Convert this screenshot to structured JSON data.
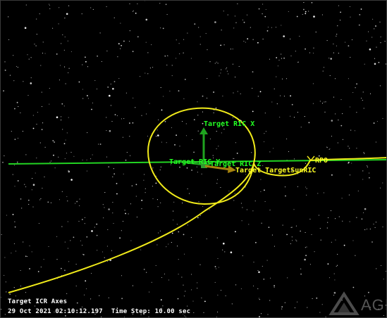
{
  "scene": {
    "axis_labels": {
      "ric_x": "Target RIC X",
      "ric_y": "Target RIC Y",
      "ric_z": "Target RIC Z",
      "sun_ric": "Target TargetSunRIC"
    },
    "object_labels": {
      "rpo": "RPO"
    },
    "colors": {
      "trajectory": "#f0ea1a",
      "track_line": "#22d422",
      "axis_label": "#22ff22",
      "sun_vector": "#a8830d",
      "axis_arrow": "#1fa31f"
    }
  },
  "status_bar": {
    "frame_label": "Target ICR Axes",
    "datetime": "29 Oct 2021 02:10:12.197",
    "time_step": "Time Step: 10.00 sec"
  },
  "watermark": {
    "text": "AGI"
  }
}
